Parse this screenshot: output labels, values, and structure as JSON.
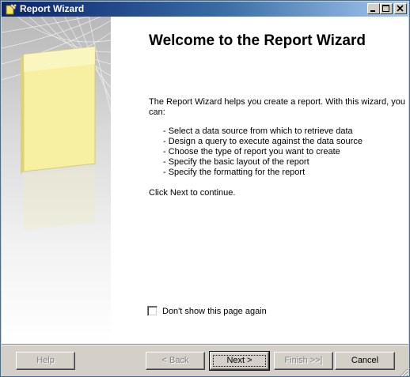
{
  "window": {
    "title": "Report Wizard",
    "icon": "report-wizard-app-icon",
    "controls": [
      "minimize-icon",
      "maximize-icon",
      "close-icon"
    ]
  },
  "main": {
    "heading": "Welcome to the Report Wizard",
    "intro": "The Report Wizard helps you create a report. With this wizard, you can:",
    "bullets": [
      "- Select a data source from which to retrieve data",
      "- Design a query to execute against the data source",
      "- Choose the type of report you want to create",
      "- Specify the basic layout of the report",
      "- Specify the formatting for the report"
    ],
    "continue_text": "Click Next to continue.",
    "dont_show_label": "Don't show this page again",
    "dont_show_checked": false
  },
  "footer": {
    "help": "Help",
    "back": "< Back",
    "next": "Next >",
    "finish": "Finish >>|",
    "cancel": "Cancel"
  },
  "colors": {
    "titlebar_start": "#0a246a",
    "titlebar_end": "#a6caf0",
    "dialog_face": "#d4d0c8",
    "content_bg": "#ffffff",
    "disabled_text": "#808080",
    "decor_yellow": "#f6f0a0"
  }
}
